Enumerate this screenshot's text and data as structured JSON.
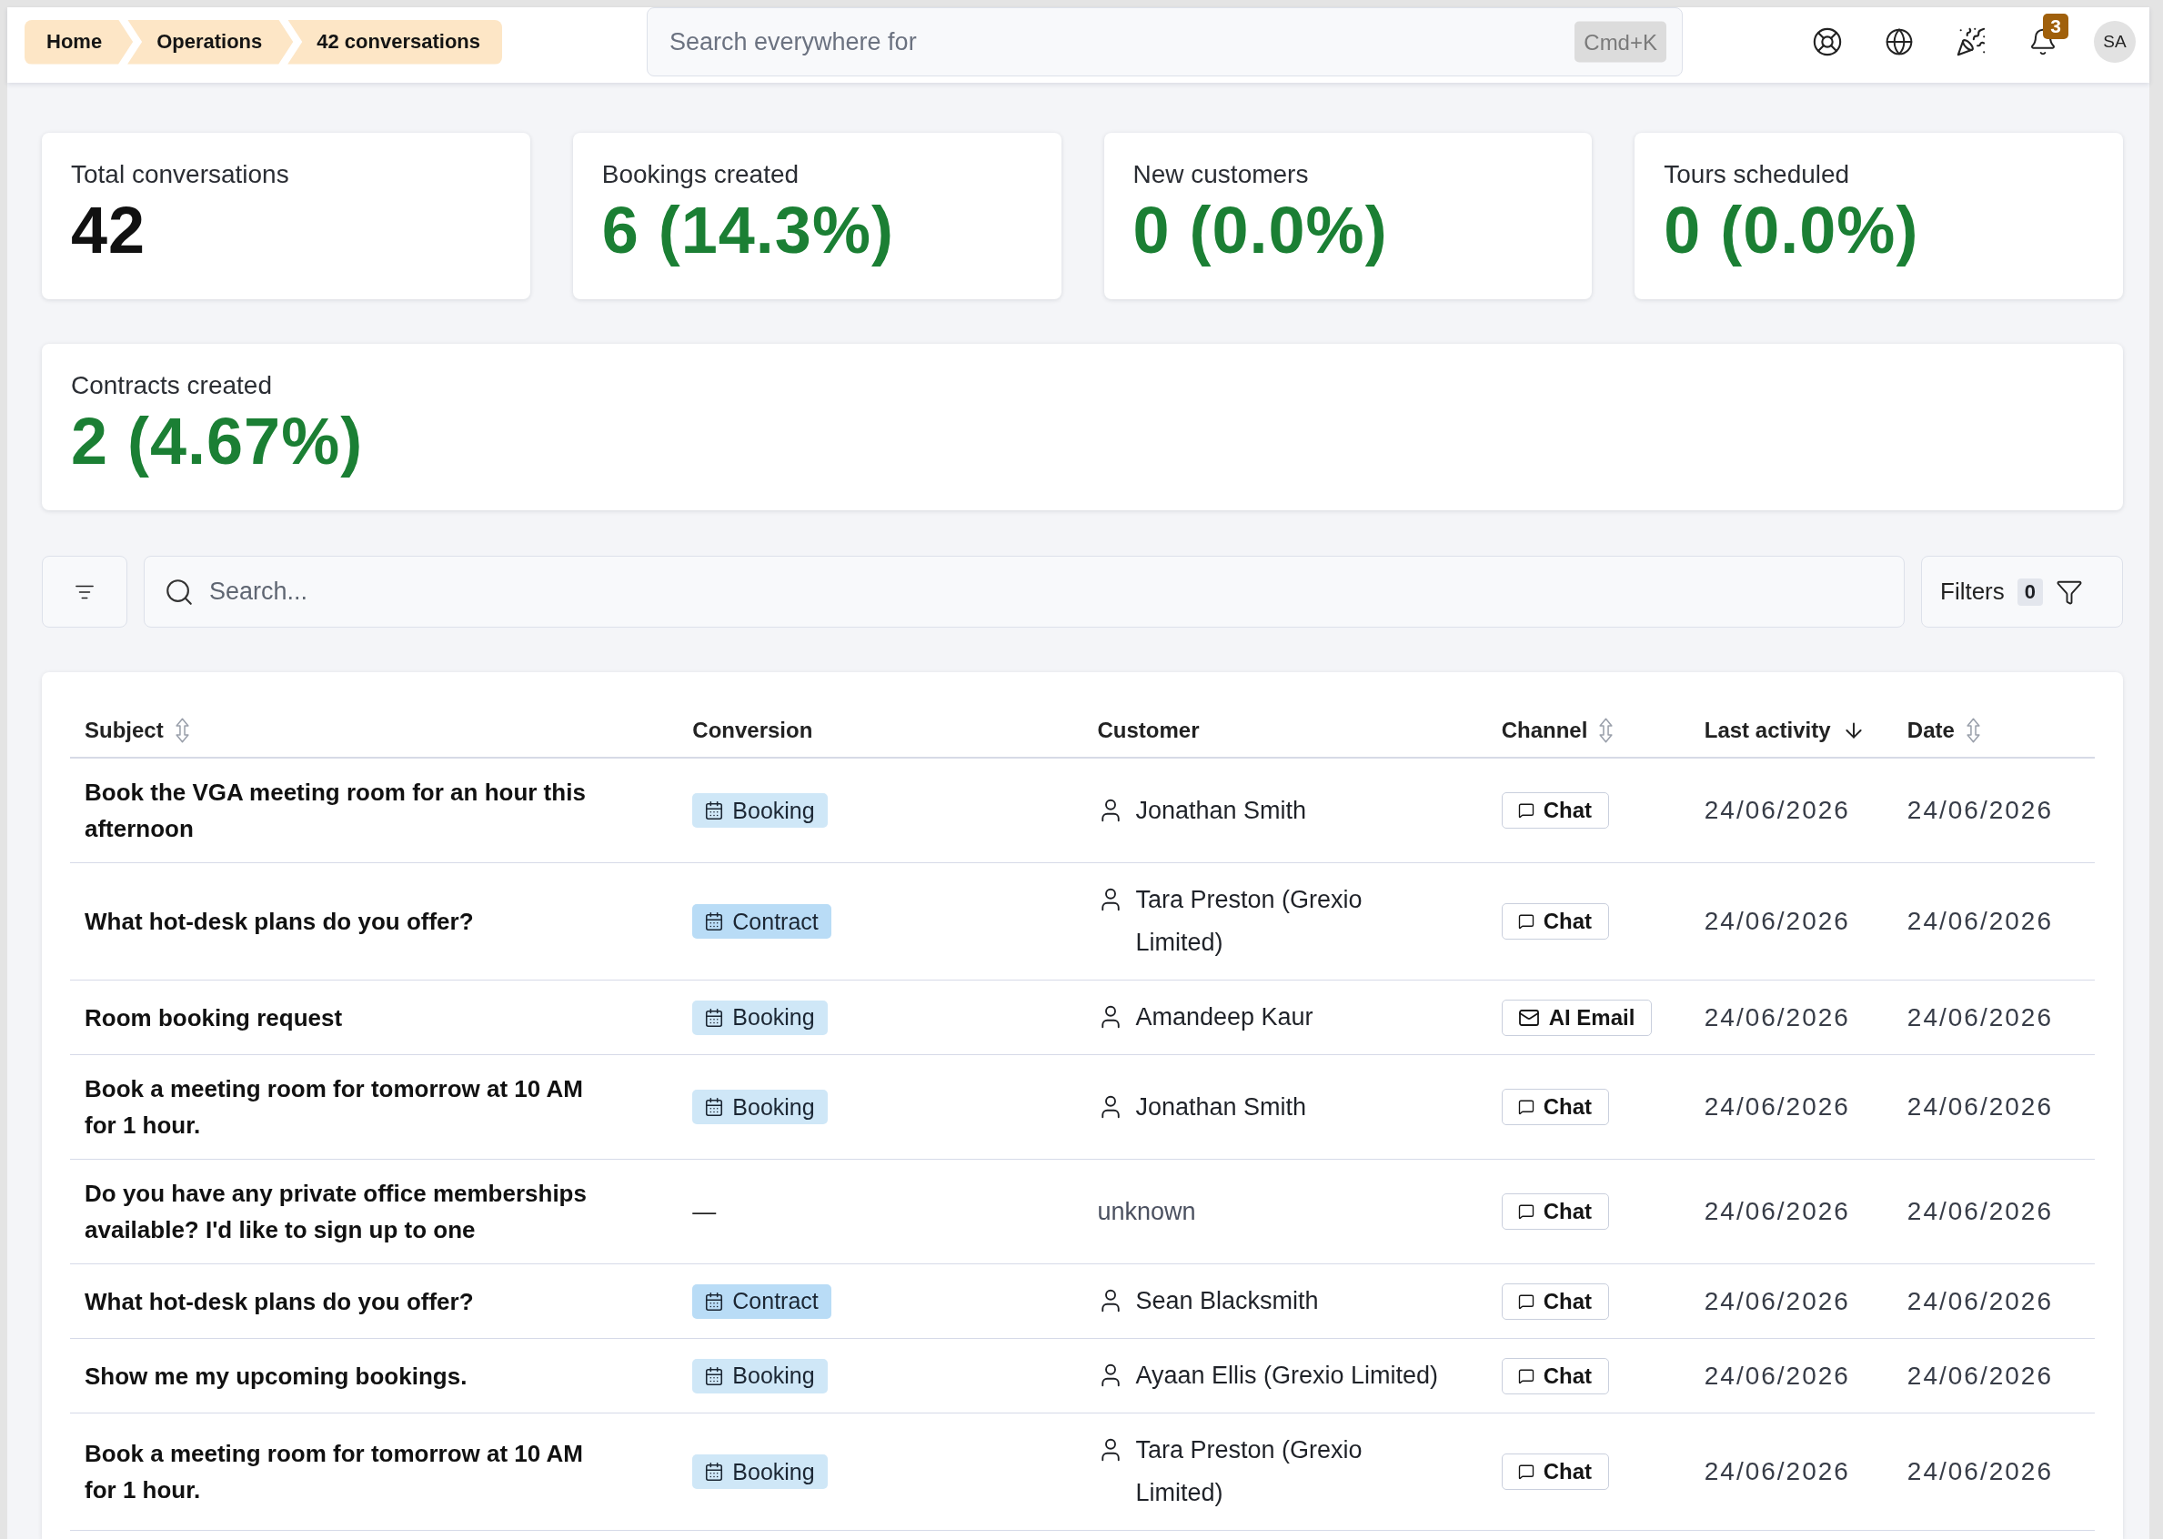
{
  "breadcrumbs": [
    "Home",
    "Operations",
    "42 conversations"
  ],
  "global_search": {
    "placeholder": "Search everywhere for",
    "shortcut": "Cmd+K"
  },
  "notifications": {
    "count": "3"
  },
  "user": {
    "initials": "SA"
  },
  "stats": [
    {
      "label": "Total conversations",
      "value": "42",
      "positive": false
    },
    {
      "label": "Bookings created",
      "value": "6 (14.3%)",
      "positive": true
    },
    {
      "label": "New customers",
      "value": "0 (0.0%)",
      "positive": true
    },
    {
      "label": "Tours scheduled",
      "value": "0 (0.0%)",
      "positive": true
    },
    {
      "label": "Contracts created",
      "value": "2 (4.67%)",
      "positive": true
    }
  ],
  "toolbar": {
    "search_placeholder": "Search...",
    "filters_label": "Filters",
    "filters_count": "0"
  },
  "table": {
    "columns": [
      {
        "label": "Subject",
        "kind": "sortable"
      },
      {
        "label": "Conversion",
        "kind": "plain"
      },
      {
        "label": "Customer",
        "kind": "plain"
      },
      {
        "label": "Channel",
        "kind": "sortable"
      },
      {
        "label": "Last activity",
        "kind": "sorted"
      },
      {
        "label": "Date",
        "kind": "sortable"
      }
    ],
    "rows": [
      {
        "subject": "Book the VGA meeting room for an hour this afternoon",
        "conversion": {
          "kind": "booking",
          "label": "Booking"
        },
        "customer": {
          "name": "Jonathan Smith",
          "known": true
        },
        "channel": {
          "kind": "chat",
          "label": "Chat"
        },
        "last_activity": "24/06/2026",
        "date": "24/06/2026"
      },
      {
        "subject": "What hot-desk plans do you offer?",
        "conversion": {
          "kind": "contract",
          "label": "Contract"
        },
        "customer": {
          "name": "Tara Preston (Grexio Limited)",
          "known": true
        },
        "channel": {
          "kind": "chat",
          "label": "Chat"
        },
        "last_activity": "24/06/2026",
        "date": "24/06/2026"
      },
      {
        "subject": "Room booking request",
        "conversion": {
          "kind": "booking",
          "label": "Booking"
        },
        "customer": {
          "name": "Amandeep Kaur",
          "known": true
        },
        "channel": {
          "kind": "email",
          "label": "AI Email"
        },
        "last_activity": "24/06/2026",
        "date": "24/06/2026"
      },
      {
        "subject": "Book a meeting room for tomorrow at 10 AM for 1 hour.",
        "conversion": {
          "kind": "booking",
          "label": "Booking"
        },
        "customer": {
          "name": "Jonathan Smith",
          "known": true
        },
        "channel": {
          "kind": "chat",
          "label": "Chat"
        },
        "last_activity": "24/06/2026",
        "date": "24/06/2026"
      },
      {
        "subject": "Do you have any private office memberships available? I'd like to sign up to one",
        "conversion": {
          "kind": "none",
          "label": "—"
        },
        "customer": {
          "name": "unknown",
          "known": false
        },
        "channel": {
          "kind": "chat",
          "label": "Chat"
        },
        "last_activity": "24/06/2026",
        "date": "24/06/2026"
      },
      {
        "subject": "What hot-desk plans do you offer?",
        "conversion": {
          "kind": "contract",
          "label": "Contract"
        },
        "customer": {
          "name": "Sean Blacksmith",
          "known": true
        },
        "channel": {
          "kind": "chat",
          "label": "Chat"
        },
        "last_activity": "24/06/2026",
        "date": "24/06/2026"
      },
      {
        "subject": "Show me my upcoming bookings.",
        "conversion": {
          "kind": "booking",
          "label": "Booking"
        },
        "customer": {
          "name": "Ayaan Ellis (Grexio Limited)",
          "known": true
        },
        "channel": {
          "kind": "chat",
          "label": "Chat"
        },
        "last_activity": "24/06/2026",
        "date": "24/06/2026"
      },
      {
        "subject": "Book a meeting room for tomorrow at 10 AM for 1 hour.",
        "conversion": {
          "kind": "booking",
          "label": "Booking"
        },
        "customer": {
          "name": "Tara Preston (Grexio Limited)",
          "known": true
        },
        "channel": {
          "kind": "chat",
          "label": "Chat"
        },
        "last_activity": "24/06/2026",
        "date": "24/06/2026"
      }
    ]
  }
}
